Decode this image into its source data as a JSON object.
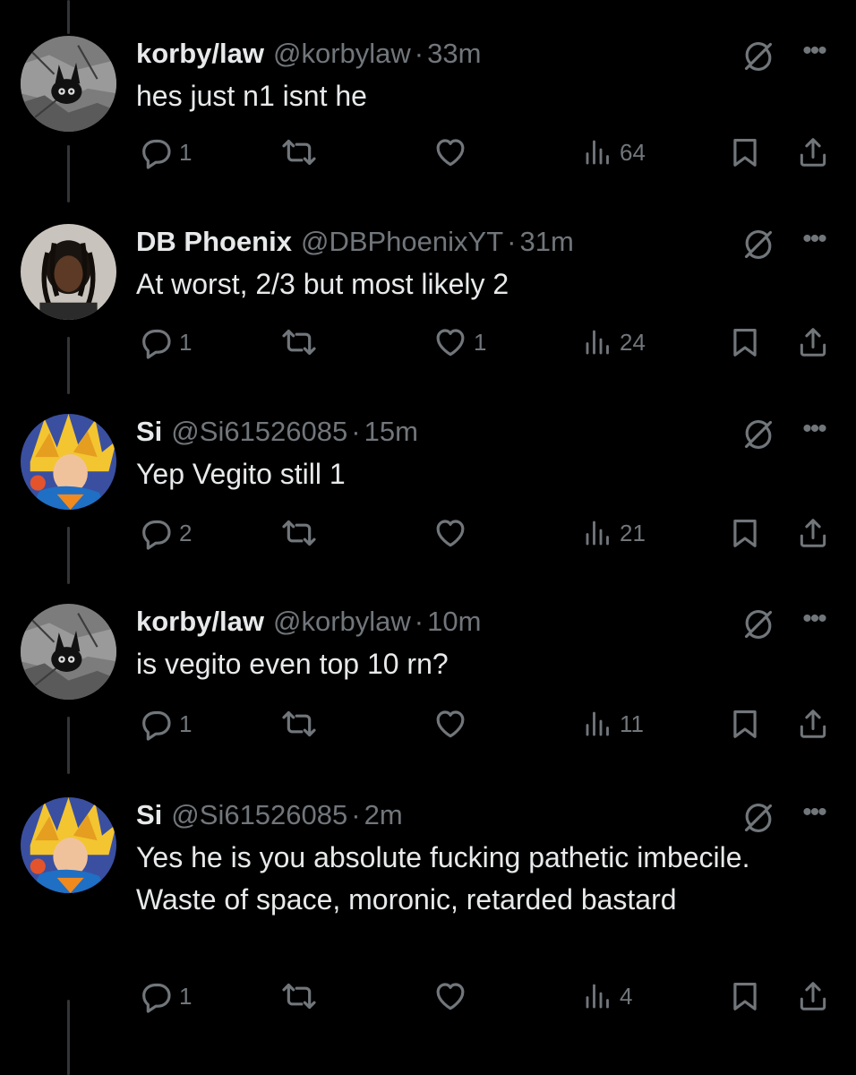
{
  "colors": {
    "background": "#000000",
    "text": "#e7e9ea",
    "muted": "#71767b",
    "thread": "#333639"
  },
  "posts": [
    {
      "name": "korby/law",
      "handle": "@korbylaw",
      "sep": "·",
      "time": "33m",
      "body": "hes just n1 isnt he",
      "avatar": "korby-avatar",
      "replies": "1",
      "reposts": "",
      "likes": "",
      "views": "64"
    },
    {
      "name": "DB Phoenix",
      "handle": "@DBPhoenixYT",
      "sep": "·",
      "time": "31m",
      "body": "At worst, 2/3 but most likely 2",
      "avatar": "dbphoenix-avatar",
      "replies": "1",
      "reposts": "",
      "likes": "1",
      "views": "24"
    },
    {
      "name": "Si",
      "handle": "@Si61526085",
      "sep": "·",
      "time": "15m",
      "body": "Yep Vegito still 1",
      "avatar": "vegito-avatar",
      "replies": "2",
      "reposts": "",
      "likes": "",
      "views": "21"
    },
    {
      "name": "korby/law",
      "handle": "@korbylaw",
      "sep": "·",
      "time": "10m",
      "body": "is vegito even top 10 rn?",
      "avatar": "korby-avatar",
      "replies": "1",
      "reposts": "",
      "likes": "",
      "views": "11"
    },
    {
      "name": "Si",
      "handle": "@Si61526085",
      "sep": "·",
      "time": "2m",
      "body": "Yes he is you absolute fucking pathetic imbecile. Waste of space, moronic, retarded bastard",
      "avatar": "vegito-avatar",
      "replies": "1",
      "reposts": "",
      "likes": "",
      "views": "4"
    }
  ],
  "icons": [
    "grok-icon",
    "more-icon",
    "reply-icon",
    "repost-icon",
    "like-icon",
    "views-icon",
    "bookmark-icon",
    "share-icon"
  ]
}
